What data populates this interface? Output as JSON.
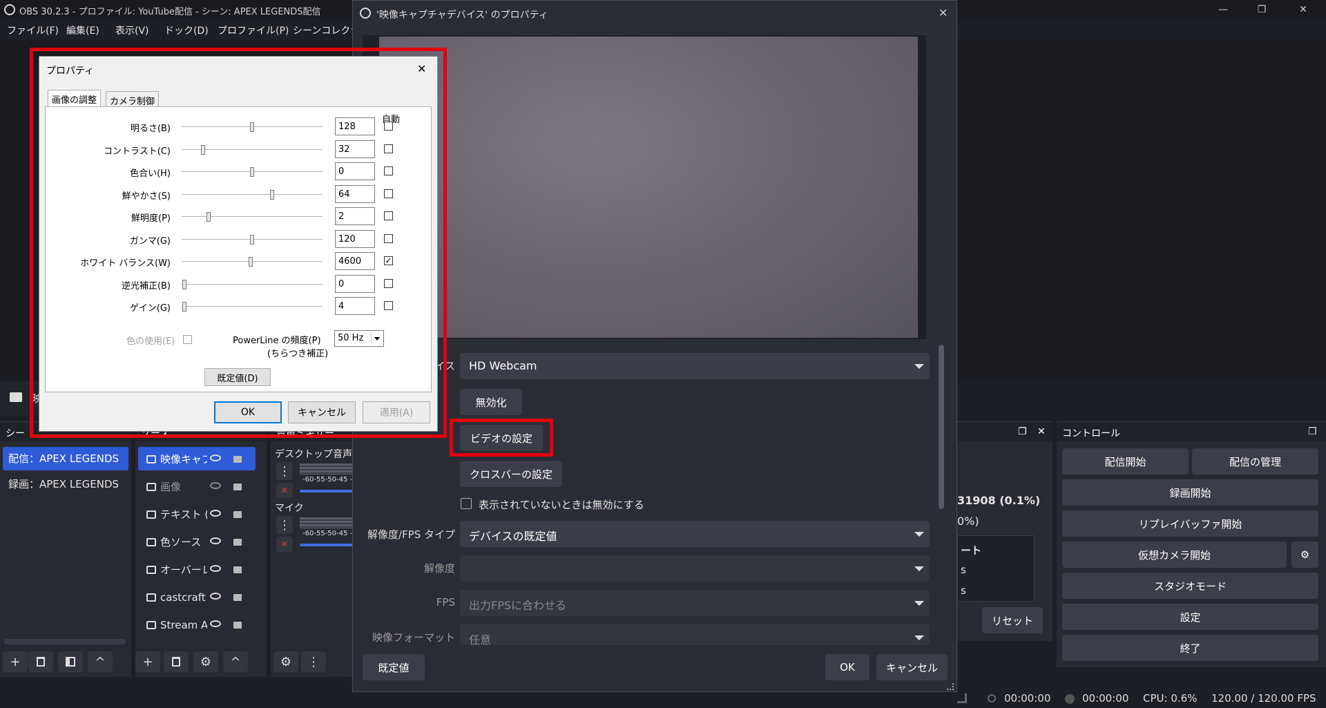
{
  "main_window": {
    "title": "OBS 30.2.3 - プロファイル: YouTube配信 - シーン: APEX LEGENDS配信",
    "menu": [
      "ファイル(F)",
      "編集(E)",
      "表示(V)",
      "ドック(D)",
      "プロファイル(P)",
      "シーンコレクシ"
    ],
    "window_controls": {
      "minimize": "—",
      "restore": "❐",
      "close": "✕"
    }
  },
  "preview_bar": {
    "camera_label": "映"
  },
  "scenes_dock": {
    "title": "シー",
    "items": [
      "配信：APEX LEGENDS",
      "録画：APEX LEGENDS"
    ],
    "selected_index": 0
  },
  "sources_dock": {
    "title": "ソース",
    "items": [
      {
        "label": "映像キャプ",
        "icon": "camera-icon",
        "visible": true,
        "selected": true
      },
      {
        "label": "画像",
        "icon": "image-icon",
        "visible": false,
        "selected": false
      },
      {
        "label": "テキスト (G",
        "icon": "text-icon",
        "visible": true,
        "selected": false
      },
      {
        "label": "色ソース",
        "icon": "brush-icon",
        "visible": true,
        "selected": false
      },
      {
        "label": "オーバーレ",
        "icon": "image-icon",
        "visible": true,
        "selected": false
      },
      {
        "label": "castcraft",
        "icon": "camera-icon",
        "visible": true,
        "selected": false
      },
      {
        "label": "Stream A",
        "icon": "gamepad-icon",
        "visible": true,
        "selected": false
      }
    ]
  },
  "mixer_dock": {
    "title": "音声ミキサー",
    "channels": [
      {
        "name": "デスクトップ音声",
        "scale": "-60-55-50-45 -"
      },
      {
        "name": "マイク",
        "scale": "-60-55-50-45 -"
      }
    ]
  },
  "stats_dock": {
    "values": [
      "31908 (0.1%)",
      "0%)"
    ],
    "list_items": [
      "ート",
      "s",
      "s"
    ],
    "reset_label": "リセット"
  },
  "controls_dock": {
    "title": "コントロール",
    "buttons": {
      "start_stream": "配信開始",
      "manage_stream": "配信の管理",
      "start_recording": "録画開始",
      "start_replay": "リプレイバッファ開始",
      "start_virtual_cam": "仮想カメラ開始",
      "studio_mode": "スタジオモード",
      "settings": "設定",
      "exit": "終了"
    }
  },
  "statusbar": {
    "stream_time": "00:00:00",
    "record_time": "00:00:00",
    "cpu": "CPU: 0.6%",
    "fps": "120.00 / 120.00 FPS"
  },
  "video_dialog": {
    "title": "'映像キャプチャデバイス' のプロパティ",
    "device_label": "イス",
    "device_value": "HD Webcam",
    "deactivate_label": "無効化",
    "video_settings_label": "ビデオの設定",
    "crossbar_label": "クロスバーの設定",
    "hide_checkbox_label": "表示されていないときは無効にする",
    "res_fps_type_label": "解像度/FPS タイプ",
    "res_fps_type_value": "デバイスの既定値",
    "resolution_label": "解像度",
    "resolution_value": "",
    "fps_label": "FPS",
    "fps_value": "出力FPSに合わせる",
    "format_label": "映像フォーマット",
    "format_value": "任意",
    "defaults_label": "既定値",
    "ok_label": "OK",
    "cancel_label": "キャンセル"
  },
  "props_dialog": {
    "title": "プロパティ",
    "tabs": [
      "画像の調整",
      "カメラ制御"
    ],
    "auto_header": "自動",
    "rows": [
      {
        "label": "明るさ(B)",
        "value": "128",
        "level": 0.5,
        "auto": false
      },
      {
        "label": "コントラスト(C)",
        "value": "32",
        "level": 0.15,
        "auto": false
      },
      {
        "label": "色合い(H)",
        "value": "0",
        "level": 0.5,
        "auto": false
      },
      {
        "label": "鮮やかさ(S)",
        "value": "64",
        "level": 0.64,
        "auto": false
      },
      {
        "label": "鮮明度(P)",
        "value": "2",
        "level": 0.19,
        "auto": false
      },
      {
        "label": "ガンマ(G)",
        "value": "120",
        "level": 0.5,
        "auto": false
      },
      {
        "label": "ホワイト バランス(W)",
        "value": "4600",
        "level": 0.49,
        "auto": true
      },
      {
        "label": "逆光補正(B)",
        "value": "0",
        "level": 0.02,
        "auto": false
      },
      {
        "label": "ゲイン(G)",
        "value": "4",
        "level": 0.02,
        "auto": false
      }
    ],
    "color_use_label": "色の使用(E)",
    "powerline_label": "PowerLine の頻度(P)",
    "powerline_sub": "(ちらつき補正)",
    "powerline_value": "50 Hz",
    "defaults_label": "既定値(D)",
    "ok_label": "OK",
    "cancel_label": "キャンセル",
    "apply_label": "適用(A)"
  },
  "colors": {
    "accent": "#2f5bd6",
    "highlight_red": "#e1000f",
    "meter_blue": "#3d6fe0",
    "mute_red": "#c83c3c"
  }
}
